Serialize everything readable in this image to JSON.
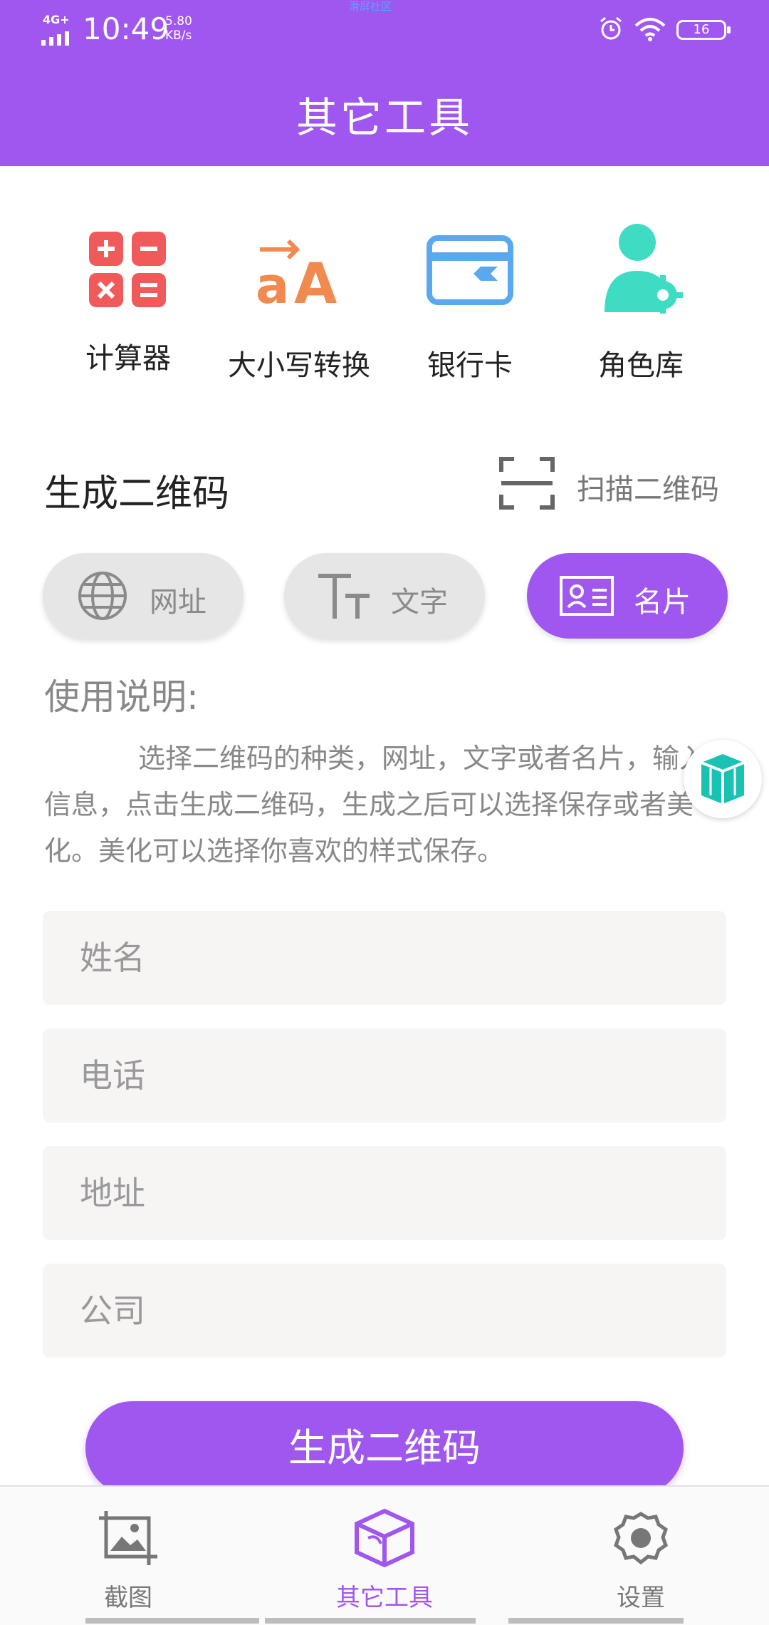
{
  "status_bar": {
    "network": "4G+",
    "time": "10:49",
    "speed_value": "5.80",
    "speed_unit": "KB/s",
    "top_center_tiny": "滑屏社区",
    "battery": "16"
  },
  "header": {
    "title": "其它工具"
  },
  "tools": [
    {
      "label": "计算器",
      "icon": "calculator-icon",
      "color": "#f05a5a"
    },
    {
      "label": "大小写转换",
      "icon": "case-convert-icon",
      "color": "#f08a4e"
    },
    {
      "label": "银行卡",
      "icon": "bank-card-icon",
      "color": "#5aa9f0"
    },
    {
      "label": "角色库",
      "icon": "role-library-icon",
      "color": "#3fdcc4"
    }
  ],
  "qr_section": {
    "title": "生成二维码",
    "scan_label": "扫描二维码",
    "modes": [
      {
        "label": "网址",
        "icon": "globe-icon",
        "active": false
      },
      {
        "label": "文字",
        "icon": "text-icon",
        "active": false
      },
      {
        "label": "名片",
        "icon": "business-card-icon",
        "active": true
      }
    ]
  },
  "instructions": {
    "title": "使用说明:",
    "body": "选择二维码的种类，网址，文字或者名片，输入信息，点击生成二维码，生成之后可以选择保存或者美化。美化可以选择你喜欢的样式保存。"
  },
  "form": {
    "name_placeholder": "姓名",
    "phone_placeholder": "电话",
    "address_placeholder": "地址",
    "company_placeholder": "公司"
  },
  "generate_button": "生成二维码",
  "bottom_nav": [
    {
      "label": "截图",
      "icon": "screenshot-icon",
      "active": false
    },
    {
      "label": "其它工具",
      "icon": "tools-box-icon",
      "active": true
    },
    {
      "label": "设置",
      "icon": "gear-icon",
      "active": false
    }
  ],
  "colors": {
    "accent": "#a057ef",
    "header_bg": "#a057ef",
    "inactive_pill": "#e6e6e6",
    "field_bg": "#f7f4f4"
  }
}
